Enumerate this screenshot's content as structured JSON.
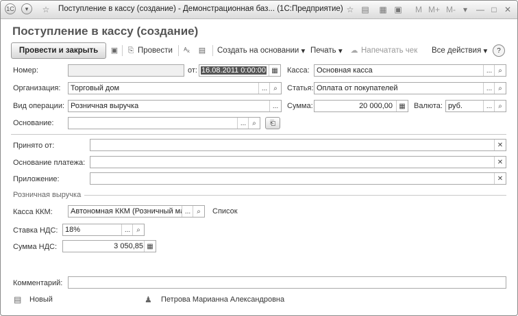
{
  "window": {
    "title": "Поступление в кассу (создание) - Демонстрационная баз...   (1С:Предприятие)",
    "titlebar_right": [
      "M",
      "M+",
      "M-"
    ]
  },
  "header": {
    "title": "Поступление в кассу (создание)"
  },
  "toolbar": {
    "post_close": "Провести и закрыть",
    "post": "Провести",
    "create_based": "Создать на основании",
    "print": "Печать",
    "print_receipt": "Напечатать чек",
    "all_actions": "Все действия",
    "help": "?"
  },
  "form": {
    "number_label": "Номер:",
    "number_value": "",
    "from_label": "от:",
    "date_value": "16.08.2011  0:00:00",
    "cashbox_label": "Касса:",
    "cashbox_value": "Основная касса",
    "org_label": "Организация:",
    "org_value": "Торговый дом",
    "article_label": "Статья:",
    "article_value": "Оплата от покупателей",
    "optype_label": "Вид операции:",
    "optype_value": "Розничная выручка",
    "sum_label": "Сумма:",
    "sum_value": "20 000,00",
    "currency_label": "Валюта:",
    "currency_value": "руб.",
    "basis_label": "Основание:",
    "basis_value": "",
    "received_label": "Принято от:",
    "received_value": "",
    "paybasis_label": "Основание платежа:",
    "paybasis_value": "",
    "attachment_label": "Приложение:",
    "attachment_value": "",
    "retail_group": "Розничная выручка",
    "kkm_label": "Касса ККМ:",
    "kkm_value": "Автономная ККМ (Розничный ма",
    "list_label": "Список",
    "vat_rate_label": "Ставка НДС:",
    "vat_rate_value": "18%",
    "vat_sum_label": "Сумма НДС:",
    "vat_sum_value": "3 050,85",
    "comment_label": "Комментарий:",
    "comment_value": ""
  },
  "footer": {
    "status": "Новый",
    "author": "Петрова Марианна Александровна"
  },
  "icons": {
    "dots": "...",
    "search": "⌕",
    "clear": "✕",
    "calendar": "▦",
    "calculator": "▦"
  }
}
